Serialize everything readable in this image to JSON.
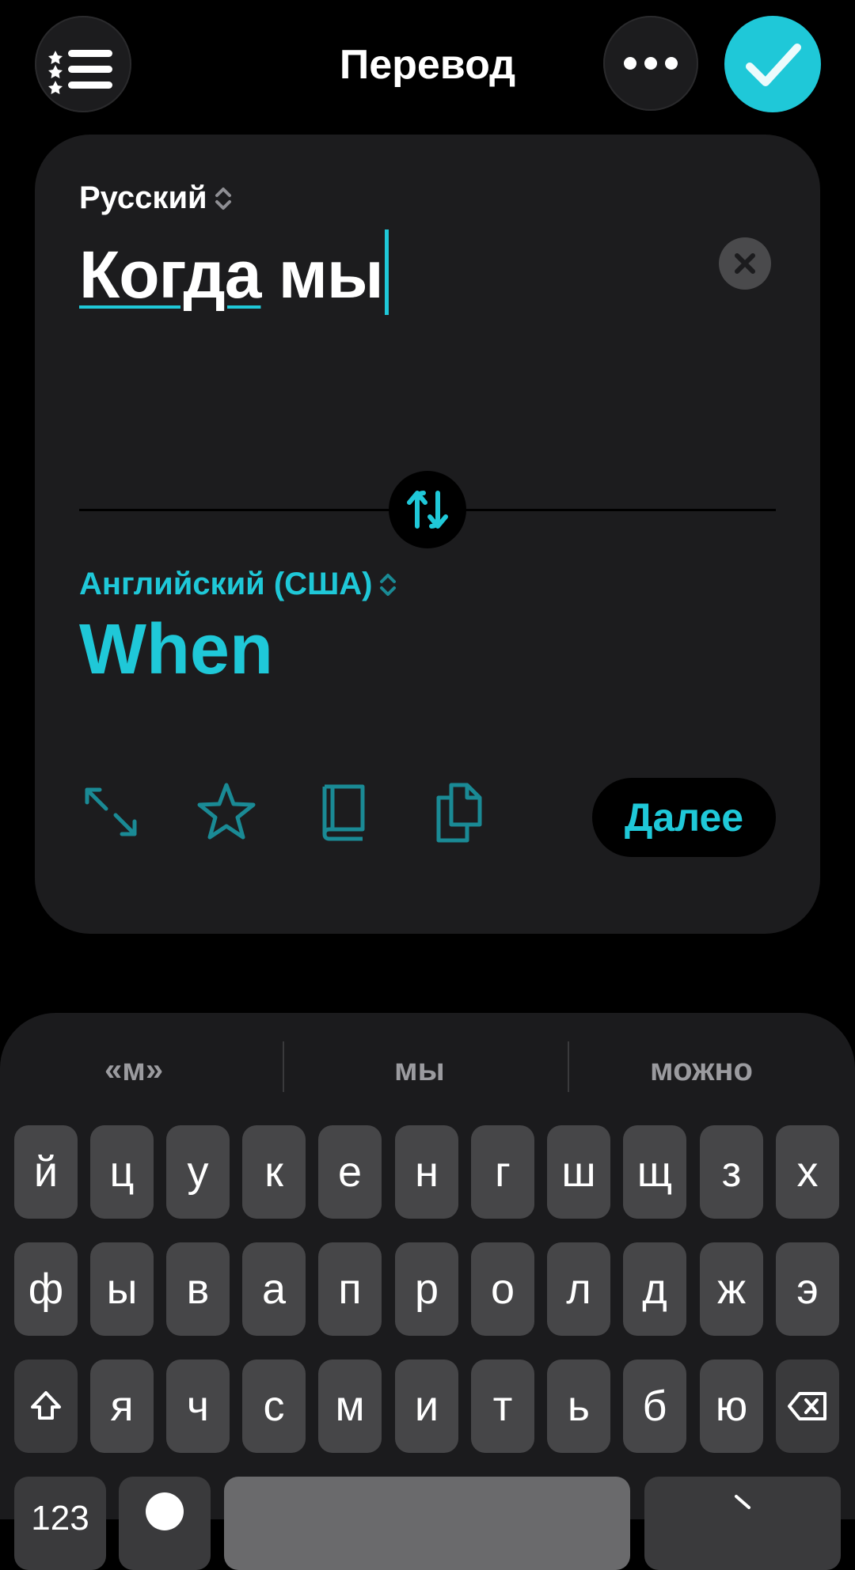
{
  "header": {
    "title": "Перевод",
    "accent_color": "#1fc8d8",
    "menu_icon": "starred-list-icon",
    "more_icon": "ellipsis-icon",
    "done_icon": "checkmark-icon"
  },
  "source": {
    "language": "Русский",
    "text_word1": "Когда",
    "text_word2": " мы"
  },
  "target": {
    "language": "Английский (США)",
    "text": "When"
  },
  "actions": {
    "expand_icon": "expand-icon",
    "favorite_icon": "star-icon",
    "dictionary_icon": "book-icon",
    "copy_icon": "copy-icon",
    "next_label": "Далее"
  },
  "keyboard": {
    "suggestions": [
      "«м»",
      "мы",
      "можно"
    ],
    "row1": [
      "й",
      "ц",
      "у",
      "к",
      "е",
      "н",
      "г",
      "ш",
      "щ",
      "з",
      "х"
    ],
    "row2": [
      "ф",
      "ы",
      "в",
      "а",
      "п",
      "р",
      "о",
      "л",
      "д",
      "ж",
      "э"
    ],
    "row3": [
      "я",
      "ч",
      "с",
      "м",
      "и",
      "т",
      "ь",
      "б",
      "ю"
    ],
    "numbers_label": "123"
  }
}
